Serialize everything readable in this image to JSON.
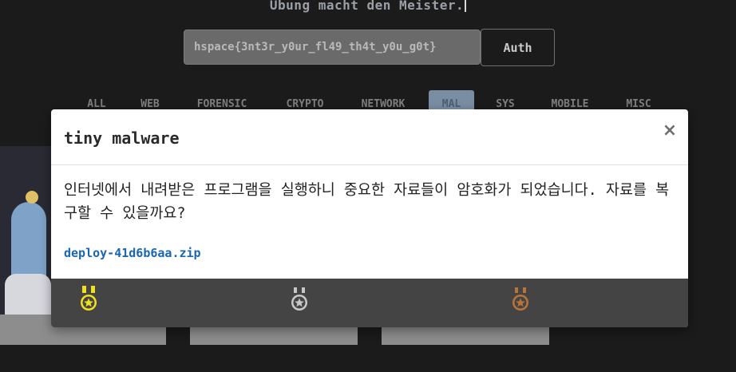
{
  "motto": "Übung macht den Meister.",
  "flag_form": {
    "input_value": "hspace{3nt3r_y0ur_fl49_th4t_y0u_g0t}",
    "auth_label": "Auth"
  },
  "category_tabs": [
    {
      "label": "ALL"
    },
    {
      "label": "WEB"
    },
    {
      "label": "FORENSIC"
    },
    {
      "label": "CRYPTO"
    },
    {
      "label": "NETWORK"
    },
    {
      "label": "MAL"
    },
    {
      "label": "SYS"
    },
    {
      "label": "MOBILE"
    },
    {
      "label": "MISC"
    }
  ],
  "active_tab": "MAL",
  "modal": {
    "title": "tiny malware",
    "close_glyph": "×",
    "description": "인터넷에서 내려받은 프로그램을 실행하니 중요한 자료들이 암호화가 되었습니다. 자료를 복구할 수 있을까요?",
    "file_link": "deploy-41d6b6aa.zip",
    "medals": [
      {
        "icon": "gold-medal-icon",
        "color": "#f0e020"
      },
      {
        "icon": "silver-medal-icon",
        "color": "#c8c8c8"
      },
      {
        "icon": "bronze-medal-icon",
        "color": "#b8743a"
      }
    ]
  },
  "colors": {
    "page_background": "#1b1b1b",
    "active_tab": "#7a8ea3",
    "link": "#1a66b0",
    "modal_footer": "#444444"
  }
}
